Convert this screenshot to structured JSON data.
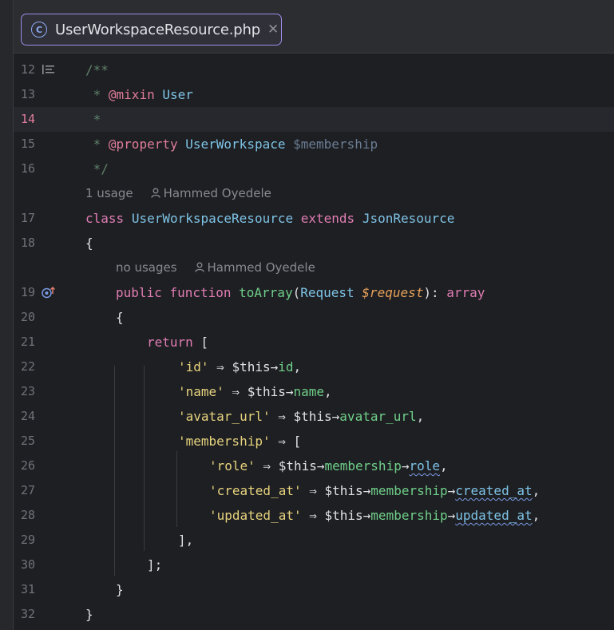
{
  "tab": {
    "icon": "C",
    "icon_name": "php-class-icon",
    "title": "UserWorkspaceResource.php",
    "close": "✕"
  },
  "gutter": {
    "line_numbers": [
      "12",
      "13",
      "14",
      "15",
      "16",
      "17",
      "18",
      "19",
      "20",
      "21",
      "22",
      "23",
      "24",
      "25",
      "26",
      "27",
      "28",
      "29",
      "30",
      "31",
      "32"
    ],
    "current_line": "14"
  },
  "hints": {
    "class_usage": "1 usage",
    "class_author": "Hammed Oyedele",
    "method_usage": "no usages",
    "method_author": "Hammed Oyedele"
  },
  "code": {
    "l12": "/**",
    "l13": {
      "star": " * ",
      "tag": "@mixin",
      "type": "User"
    },
    "l14": " *",
    "l15": {
      "star": " * ",
      "tag": "@property",
      "type": "UserWorkspace",
      "var": "$membership"
    },
    "l16": " */",
    "l17": {
      "kw1": "class",
      "name": "UserWorkspaceResource",
      "kw2": "extends",
      "parent": "JsonResource"
    },
    "l18": "{",
    "l19": {
      "kw1": "public",
      "kw2": "function",
      "fn": "toArray",
      "open": "(",
      "type": "Request",
      "param": "$request",
      "close": "): ",
      "ret": "array"
    },
    "l20": "{",
    "l21": {
      "kw": "return",
      "rest": " ["
    },
    "l22": {
      "key": "'id'",
      "arrow": " ⇒ ",
      "this": "$this→",
      "prop": "id",
      "end": ","
    },
    "l23": {
      "key": "'name'",
      "arrow": " ⇒ ",
      "this": "$this→",
      "prop": "name",
      "end": ","
    },
    "l24": {
      "key": "'avatar_url'",
      "arrow": " ⇒ ",
      "this": "$this→",
      "prop": "avatar_url",
      "end": ","
    },
    "l25": {
      "key": "'membership'",
      "arrow": " ⇒ ",
      "rest": "["
    },
    "l26": {
      "key": "'role'",
      "arrow": " ⇒ ",
      "this": "$this→",
      "prop": "membership",
      "arrow2": "→",
      "sub": "role",
      "end": ","
    },
    "l27": {
      "key": "'created_at'",
      "arrow": " ⇒ ",
      "this": "$this→",
      "prop": "membership",
      "arrow2": "→",
      "sub": "created_at",
      "end": ","
    },
    "l28": {
      "key": "'updated_at'",
      "arrow": " ⇒ ",
      "this": "$this→",
      "prop": "membership",
      "arrow2": "→",
      "sub": "updated_at",
      "end": ","
    },
    "l29": "],",
    "l30": "];",
    "l31": "}",
    "l32": "}"
  },
  "gutter_icons": {
    "line12": "doc-comment-toggle-icon",
    "line19": "implements-method-icon"
  }
}
